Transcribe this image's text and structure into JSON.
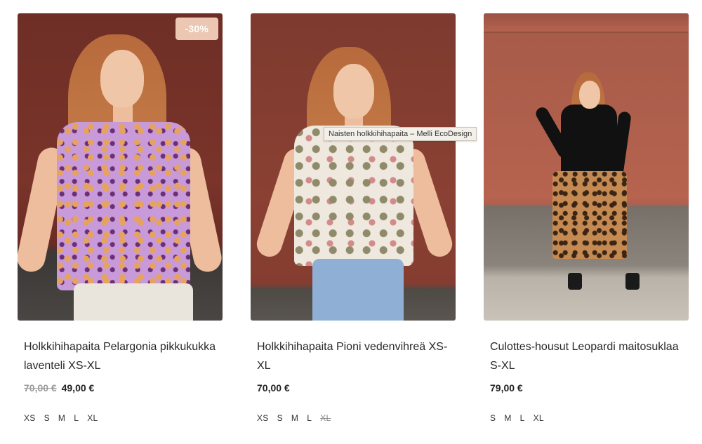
{
  "tooltip": "Naisten holkkihihapaita – Melli EcoDesign",
  "products": [
    {
      "title": "Holkkihihapaita Pelargonia pikkukukka laventeli XS-XL",
      "badge": "-30%",
      "old_price": "70,00 €",
      "price": "49,00 €",
      "sizes": [
        "XS",
        "S",
        "M",
        "L",
        "XL"
      ]
    },
    {
      "title": "Holkkihihapaita Pioni vedenvihreä XS-XL",
      "price": "70,00 €",
      "sizes": [
        "XS",
        "S",
        "M",
        "L"
      ],
      "sizes_unavailable": [
        "XL"
      ]
    },
    {
      "title": "Culottes-housut Leopardi maitosuklaa S-XL",
      "price": "79,00 €",
      "sizes": [
        "S",
        "M",
        "L",
        "XL"
      ]
    }
  ],
  "colors": {
    "badge_bg": "#ecc7b3",
    "old_price": "#9a9a9a"
  }
}
